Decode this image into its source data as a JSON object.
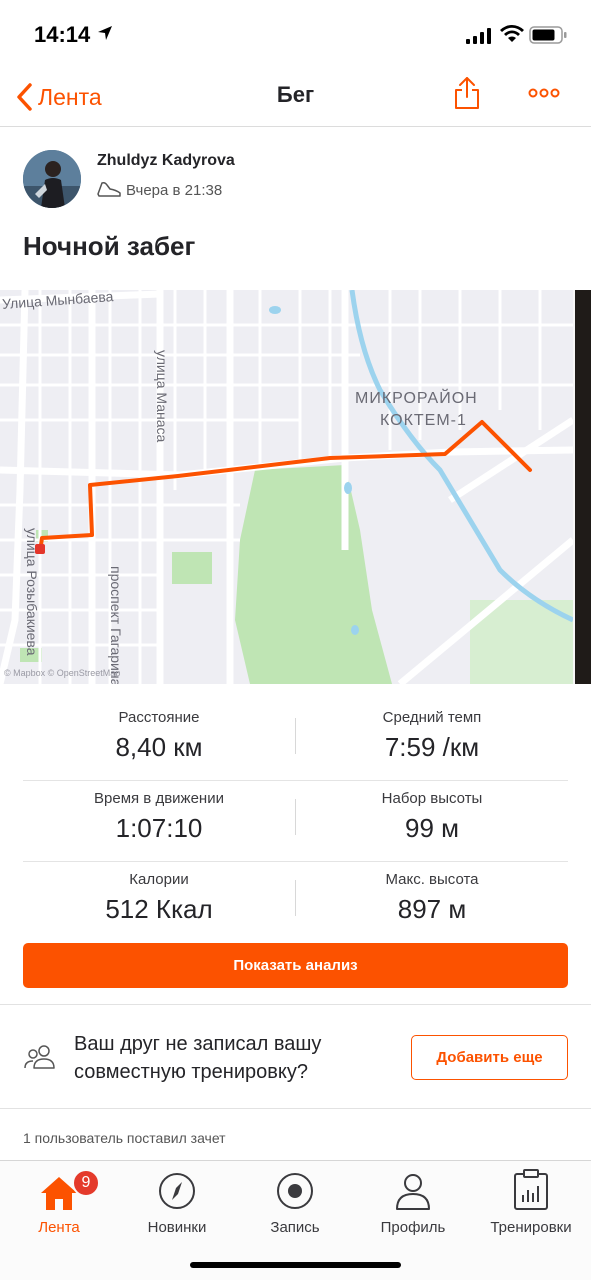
{
  "status_bar": {
    "time": "14:14"
  },
  "nav": {
    "back_label": "Лента",
    "title": "Бег"
  },
  "athlete": {
    "name": "Zhuldyz Kadyrova",
    "date": "Вчера в 21:38"
  },
  "activity": {
    "title": "Ночной забег"
  },
  "map": {
    "labels": {
      "street_1": "Улица Мынбаева",
      "street_2": "улица Манаса",
      "district": "МИКРОРАЙОН",
      "district_2": "КОКТЕМ-1",
      "street_3": "улица Розыбакиева",
      "street_4": "проспект Гагарина",
      "attribution": "© Mapbox © OpenStreetMap"
    },
    "route_color": "#fc5200"
  },
  "stats": [
    {
      "left": {
        "label": "Расстояние",
        "value": "8,40 км"
      },
      "right": {
        "label": "Средний темп",
        "value": "7:59 /км"
      }
    },
    {
      "left": {
        "label": "Время в движении",
        "value": "1:07:10"
      },
      "right": {
        "label": "Набор высоты",
        "value": "99 м"
      }
    },
    {
      "left": {
        "label": "Калории",
        "value": "512 Ккал"
      },
      "right": {
        "label": "Макс. высота",
        "value": "897 м"
      }
    }
  ],
  "analysis_button": "Показать анализ",
  "friend": {
    "text": "Ваш друг не записал вашу совместную тренировку?",
    "button": "Добавить еще"
  },
  "kudos": "1 пользователь поставил зачет",
  "tabs": [
    {
      "label": "Лента",
      "icon": "home-icon",
      "badge": "9",
      "active": true
    },
    {
      "label": "Новинки",
      "icon": "compass-icon"
    },
    {
      "label": "Запись",
      "icon": "record-icon"
    },
    {
      "label": "Профиль",
      "icon": "profile-icon"
    },
    {
      "label": "Тренировки",
      "icon": "training-log-icon"
    }
  ],
  "colors": {
    "accent": "#fc5200",
    "badge": "#e43a2b",
    "text": "#242428"
  }
}
